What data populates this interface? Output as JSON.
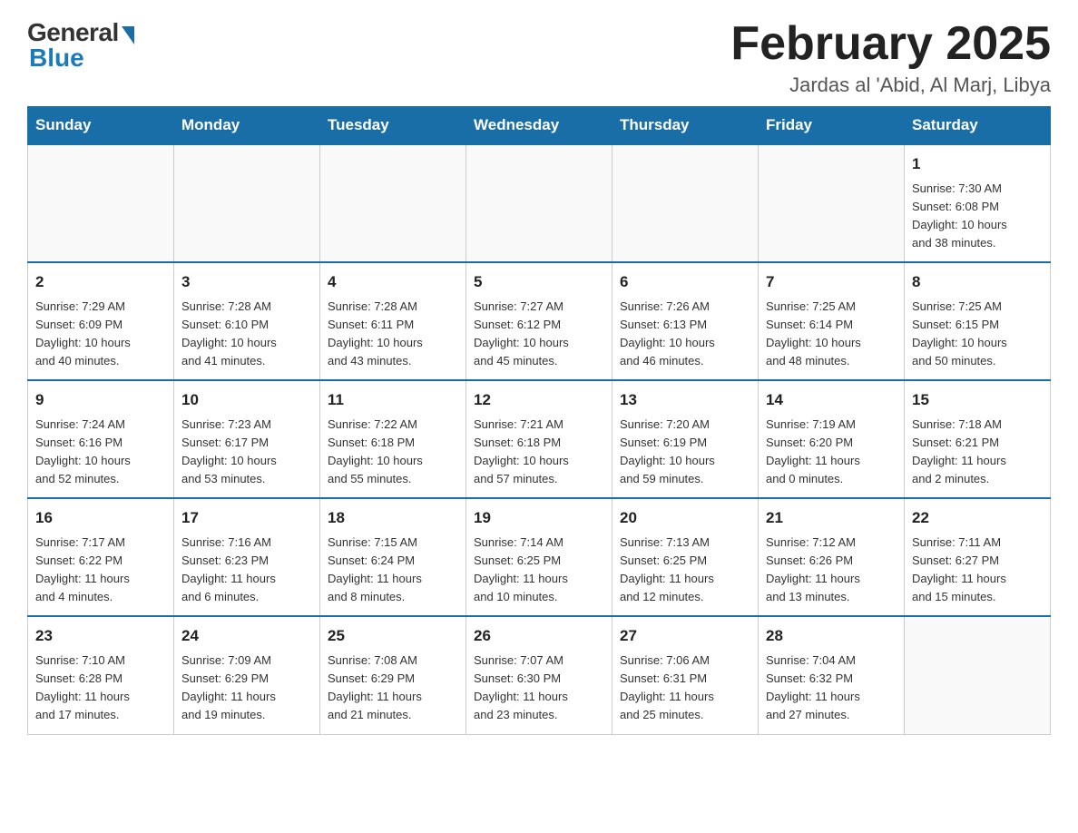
{
  "logo": {
    "general": "General",
    "blue": "Blue"
  },
  "title": "February 2025",
  "location": "Jardas al 'Abid, Al Marj, Libya",
  "days_of_week": [
    "Sunday",
    "Monday",
    "Tuesday",
    "Wednesday",
    "Thursday",
    "Friday",
    "Saturday"
  ],
  "weeks": [
    [
      {
        "day": "",
        "info": ""
      },
      {
        "day": "",
        "info": ""
      },
      {
        "day": "",
        "info": ""
      },
      {
        "day": "",
        "info": ""
      },
      {
        "day": "",
        "info": ""
      },
      {
        "day": "",
        "info": ""
      },
      {
        "day": "1",
        "info": "Sunrise: 7:30 AM\nSunset: 6:08 PM\nDaylight: 10 hours\nand 38 minutes."
      }
    ],
    [
      {
        "day": "2",
        "info": "Sunrise: 7:29 AM\nSunset: 6:09 PM\nDaylight: 10 hours\nand 40 minutes."
      },
      {
        "day": "3",
        "info": "Sunrise: 7:28 AM\nSunset: 6:10 PM\nDaylight: 10 hours\nand 41 minutes."
      },
      {
        "day": "4",
        "info": "Sunrise: 7:28 AM\nSunset: 6:11 PM\nDaylight: 10 hours\nand 43 minutes."
      },
      {
        "day": "5",
        "info": "Sunrise: 7:27 AM\nSunset: 6:12 PM\nDaylight: 10 hours\nand 45 minutes."
      },
      {
        "day": "6",
        "info": "Sunrise: 7:26 AM\nSunset: 6:13 PM\nDaylight: 10 hours\nand 46 minutes."
      },
      {
        "day": "7",
        "info": "Sunrise: 7:25 AM\nSunset: 6:14 PM\nDaylight: 10 hours\nand 48 minutes."
      },
      {
        "day": "8",
        "info": "Sunrise: 7:25 AM\nSunset: 6:15 PM\nDaylight: 10 hours\nand 50 minutes."
      }
    ],
    [
      {
        "day": "9",
        "info": "Sunrise: 7:24 AM\nSunset: 6:16 PM\nDaylight: 10 hours\nand 52 minutes."
      },
      {
        "day": "10",
        "info": "Sunrise: 7:23 AM\nSunset: 6:17 PM\nDaylight: 10 hours\nand 53 minutes."
      },
      {
        "day": "11",
        "info": "Sunrise: 7:22 AM\nSunset: 6:18 PM\nDaylight: 10 hours\nand 55 minutes."
      },
      {
        "day": "12",
        "info": "Sunrise: 7:21 AM\nSunset: 6:18 PM\nDaylight: 10 hours\nand 57 minutes."
      },
      {
        "day": "13",
        "info": "Sunrise: 7:20 AM\nSunset: 6:19 PM\nDaylight: 10 hours\nand 59 minutes."
      },
      {
        "day": "14",
        "info": "Sunrise: 7:19 AM\nSunset: 6:20 PM\nDaylight: 11 hours\nand 0 minutes."
      },
      {
        "day": "15",
        "info": "Sunrise: 7:18 AM\nSunset: 6:21 PM\nDaylight: 11 hours\nand 2 minutes."
      }
    ],
    [
      {
        "day": "16",
        "info": "Sunrise: 7:17 AM\nSunset: 6:22 PM\nDaylight: 11 hours\nand 4 minutes."
      },
      {
        "day": "17",
        "info": "Sunrise: 7:16 AM\nSunset: 6:23 PM\nDaylight: 11 hours\nand 6 minutes."
      },
      {
        "day": "18",
        "info": "Sunrise: 7:15 AM\nSunset: 6:24 PM\nDaylight: 11 hours\nand 8 minutes."
      },
      {
        "day": "19",
        "info": "Sunrise: 7:14 AM\nSunset: 6:25 PM\nDaylight: 11 hours\nand 10 minutes."
      },
      {
        "day": "20",
        "info": "Sunrise: 7:13 AM\nSunset: 6:25 PM\nDaylight: 11 hours\nand 12 minutes."
      },
      {
        "day": "21",
        "info": "Sunrise: 7:12 AM\nSunset: 6:26 PM\nDaylight: 11 hours\nand 13 minutes."
      },
      {
        "day": "22",
        "info": "Sunrise: 7:11 AM\nSunset: 6:27 PM\nDaylight: 11 hours\nand 15 minutes."
      }
    ],
    [
      {
        "day": "23",
        "info": "Sunrise: 7:10 AM\nSunset: 6:28 PM\nDaylight: 11 hours\nand 17 minutes."
      },
      {
        "day": "24",
        "info": "Sunrise: 7:09 AM\nSunset: 6:29 PM\nDaylight: 11 hours\nand 19 minutes."
      },
      {
        "day": "25",
        "info": "Sunrise: 7:08 AM\nSunset: 6:29 PM\nDaylight: 11 hours\nand 21 minutes."
      },
      {
        "day": "26",
        "info": "Sunrise: 7:07 AM\nSunset: 6:30 PM\nDaylight: 11 hours\nand 23 minutes."
      },
      {
        "day": "27",
        "info": "Sunrise: 7:06 AM\nSunset: 6:31 PM\nDaylight: 11 hours\nand 25 minutes."
      },
      {
        "day": "28",
        "info": "Sunrise: 7:04 AM\nSunset: 6:32 PM\nDaylight: 11 hours\nand 27 minutes."
      },
      {
        "day": "",
        "info": ""
      }
    ]
  ]
}
